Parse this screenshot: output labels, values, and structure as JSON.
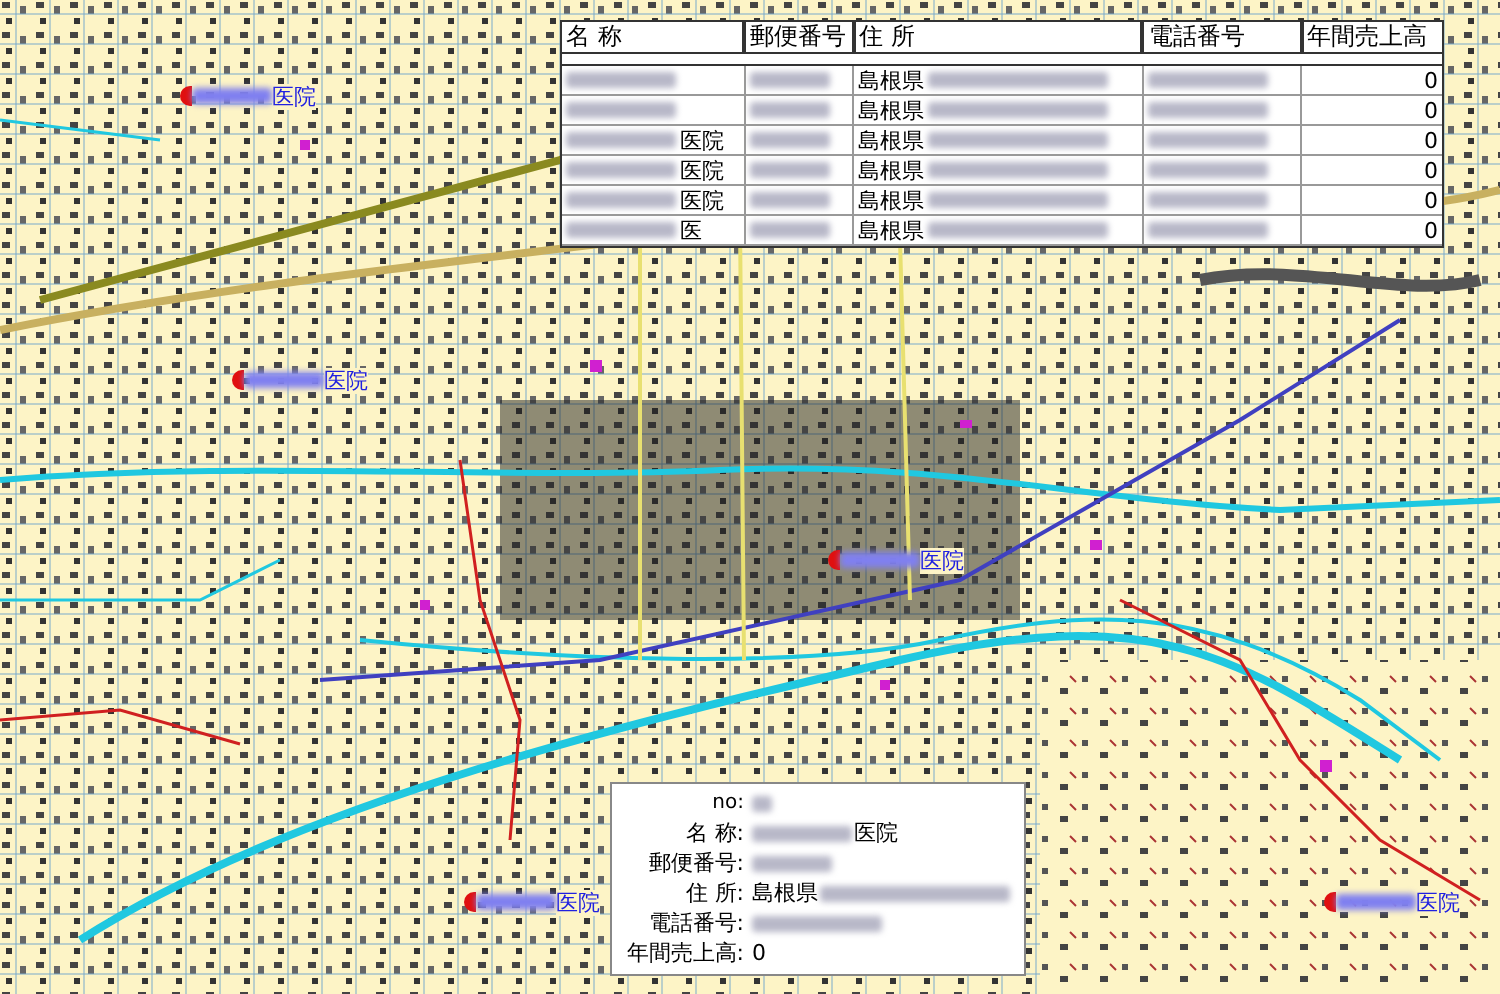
{
  "map": {
    "markers": [
      {
        "label": "医院"
      },
      {
        "label": "医院"
      },
      {
        "label": "医院"
      },
      {
        "label": "医院"
      },
      {
        "label": "医院"
      }
    ]
  },
  "table": {
    "columns": [
      "名 称",
      "郵便番号",
      "住 所",
      "電話番号",
      "年間売上高"
    ],
    "rows": [
      {
        "address": "島根県",
        "sales": "0"
      },
      {
        "address": "島根県",
        "sales": "0"
      },
      {
        "name": "医院",
        "address": "島根県",
        "sales": "0"
      },
      {
        "name": "医院",
        "address": "島根県",
        "sales": "0"
      },
      {
        "name": "医院",
        "address": "島根県",
        "sales": "0"
      },
      {
        "name": "医",
        "address": "島根県",
        "sales": "0"
      }
    ]
  },
  "popup": {
    "fields": [
      {
        "label": "no:"
      },
      {
        "label": "名 称:",
        "value": "医院"
      },
      {
        "label": "郵便番号:"
      },
      {
        "label": "住 所:",
        "value": "島根県"
      },
      {
        "label": "電話番号:"
      },
      {
        "label": "年間売上高:",
        "value": "0"
      }
    ]
  }
}
